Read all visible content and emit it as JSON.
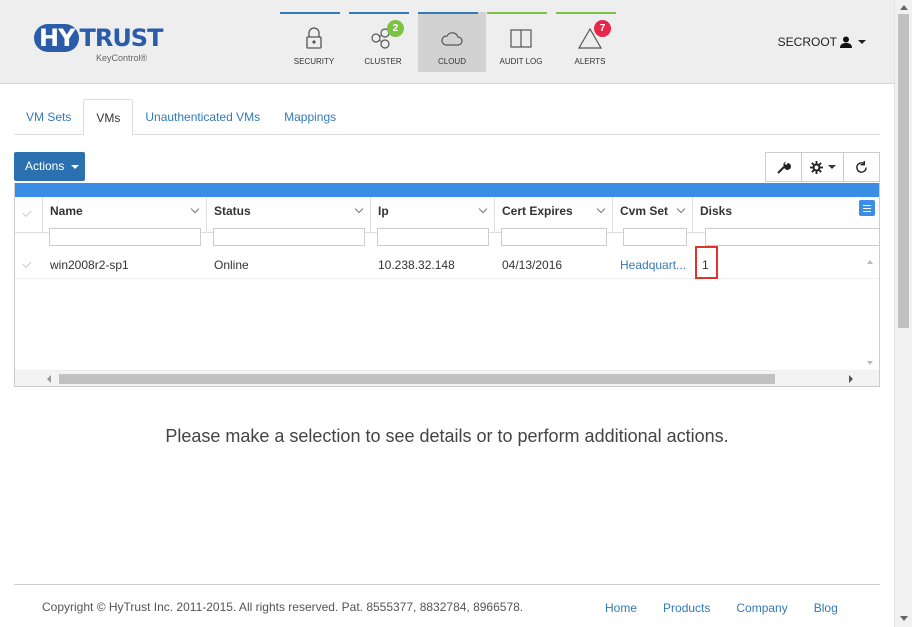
{
  "header": {
    "logo_main": "HYTRUST",
    "logo_sub": "KeyControl®",
    "nav": [
      {
        "label": "Security",
        "icon": "lock-icon",
        "bar_color": "#337ab7",
        "badge": "",
        "active": false
      },
      {
        "label": "Cluster",
        "icon": "cluster-icon",
        "bar_color": "#337ab7",
        "badge": "2",
        "badge_color": "#7cc243",
        "active": false
      },
      {
        "label": "Cloud",
        "icon": "cloud-icon",
        "bar_color": "#337ab7",
        "badge": "",
        "active": true
      },
      {
        "label": "Audit Log",
        "icon": "book-icon",
        "bar_color": "#7cc243",
        "badge": "",
        "active": false
      },
      {
        "label": "Alerts",
        "icon": "warning-icon",
        "bar_color": "#7cc243",
        "badge": "7",
        "badge_color": "#e8264a",
        "active": false
      }
    ],
    "user": "SECROOT"
  },
  "tabs": [
    "VM Sets",
    "VMs",
    "Unauthenticated VMs",
    "Mappings"
  ],
  "toolbar": {
    "actions_label": "Actions"
  },
  "grid": {
    "columns": [
      "Name",
      "Status",
      "Ip",
      "Cert Expires",
      "Cvm Set",
      "Disks"
    ],
    "rows": [
      {
        "name": "win2008r2-sp1",
        "status": "Online",
        "ip": "10.238.32.148",
        "cert_expires": "04/13/2016",
        "cvm_set": "Headquart...",
        "disks": "1"
      }
    ]
  },
  "message": "Please make a selection to see details or to perform additional actions.",
  "footer": {
    "copyright": "Copyright © HyTrust Inc. 2011-2015. All rights reserved. Pat. 8555377, 8832784, 8966578.",
    "links": [
      "Home",
      "Products",
      "Company",
      "Blog"
    ]
  },
  "colors": {
    "accent": "#337ab7",
    "grid_bar": "#3a8ee6",
    "highlight": "#e0332b"
  }
}
